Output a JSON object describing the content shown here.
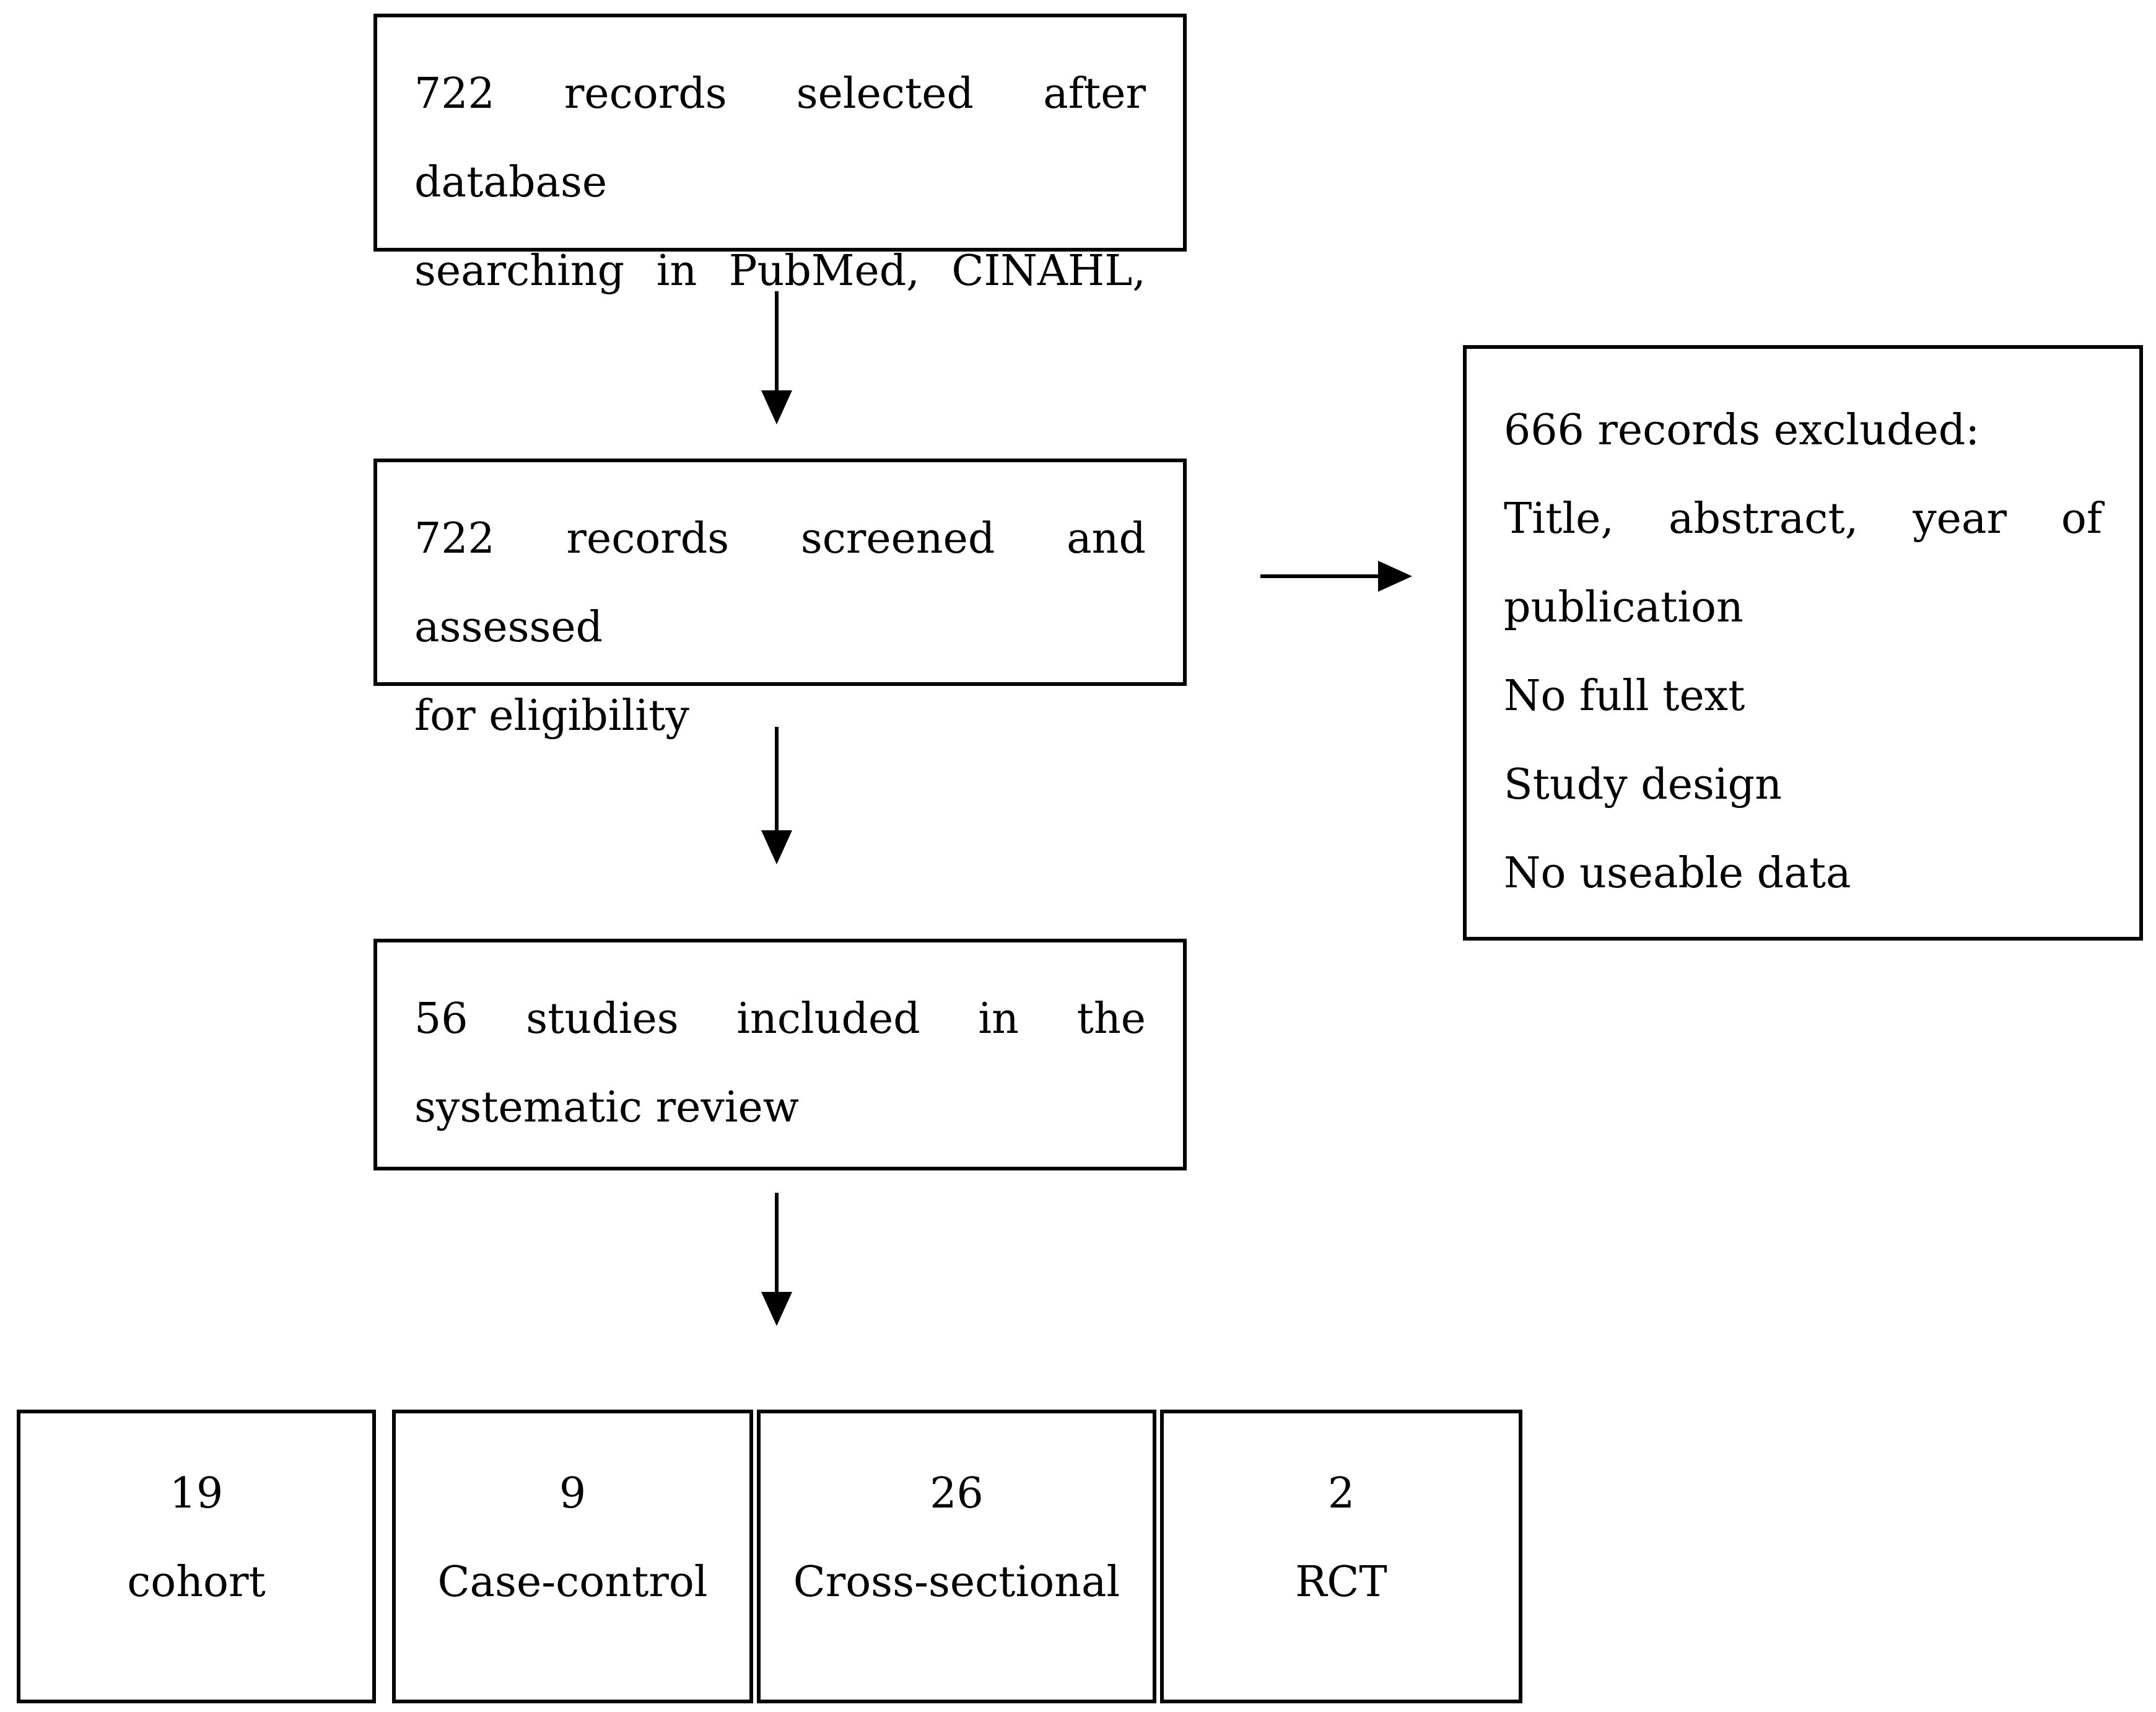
{
  "flow": {
    "identification": {
      "lines": [
        "722 records selected after database",
        "searching in PubMed, CINAHL,"
      ]
    },
    "screening": {
      "lines": [
        "722 records screened and assessed",
        "for eligibility"
      ]
    },
    "excluded": {
      "heading": "666 records excluded:",
      "reasons": [
        "Title, abstract, year of",
        "publication",
        "No full text",
        "Study design",
        "No useable data"
      ]
    },
    "included": {
      "lines": [
        "56 studies included in the",
        "systematic review"
      ]
    },
    "study_types": [
      {
        "count": "19",
        "label": "cohort"
      },
      {
        "count": "9",
        "label": "Case-control"
      },
      {
        "count": "26",
        "label": "Cross-sectional"
      },
      {
        "count": "2",
        "label": "RCT"
      }
    ]
  }
}
